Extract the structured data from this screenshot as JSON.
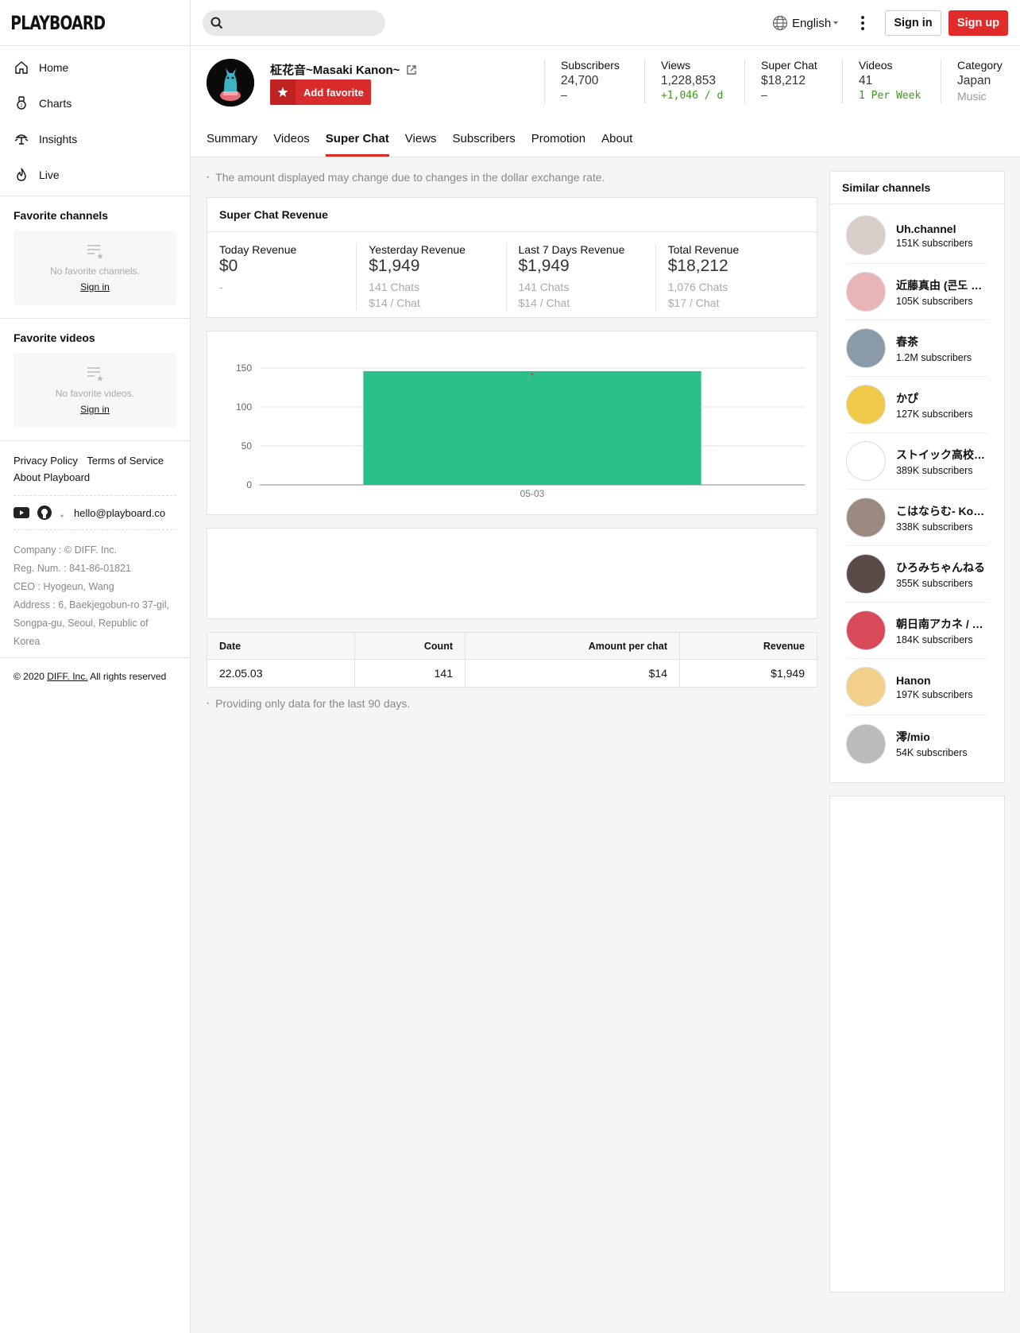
{
  "brand": {
    "logo": "PLAYBOARD"
  },
  "nav": [
    {
      "label": "Home",
      "icon": "home-icon"
    },
    {
      "label": "Charts",
      "icon": "medal-icon"
    },
    {
      "label": "Insights",
      "icon": "bulb-icon"
    },
    {
      "label": "Live",
      "icon": "flame-icon"
    }
  ],
  "favorites": {
    "channels_title": "Favorite channels",
    "channels_empty": "No favorite channels.",
    "videos_title": "Favorite videos",
    "videos_empty": "No favorite videos.",
    "signin": "Sign in"
  },
  "footer": {
    "privacy": "Privacy Policy",
    "terms": "Terms of Service",
    "about": "About Playboard",
    "email": "hello@playboard.co",
    "company": "Company : © DIFF. Inc.",
    "reg": "Reg. Num. : 841-86-01821",
    "ceo": "CEO : Hyogeun, Wang",
    "address": "Address : 6, Baekjegobun-ro 37-gil, Songpa-gu, Seoul, Republic of Korea",
    "copyright_pre": "© 2020",
    "copyright_link": "DIFF. Inc.",
    "copyright_post": "All rights reserved"
  },
  "topbar": {
    "language": "English",
    "signin": "Sign in",
    "signup": "Sign up"
  },
  "channel": {
    "name": "柾花音~Masaki Kanon~",
    "add_favorite": "Add favorite",
    "stats": [
      {
        "label": "Subscribers",
        "value": "24,700",
        "sub": "–",
        "sub_style": "plain"
      },
      {
        "label": "Views",
        "value": "1,228,853",
        "sub": "+1,046 / d",
        "sub_style": "green"
      },
      {
        "label": "Super Chat",
        "value": "$18,212",
        "sub": "–",
        "sub_style": "plain"
      },
      {
        "label": "Videos",
        "value": "41",
        "sub": "1 Per Week",
        "sub_style": "green"
      },
      {
        "label": "Category",
        "value": "Japan",
        "sub": "Music",
        "sub_style": "gray"
      }
    ]
  },
  "tabs": [
    "Summary",
    "Videos",
    "Super Chat",
    "Views",
    "Subscribers",
    "Promotion",
    "About"
  ],
  "active_tab": "Super Chat",
  "notice": "The amount displayed may change due to changes in the dollar exchange rate.",
  "revenue": {
    "title": "Super Chat Revenue",
    "cols": [
      {
        "label": "Today Revenue",
        "value": "$0",
        "line1": "-",
        "line2": ""
      },
      {
        "label": "Yesterday Revenue",
        "value": "$1,949",
        "line1": "141 Chats",
        "line2": "$14 / Chat"
      },
      {
        "label": "Last 7 Days Revenue",
        "value": "$1,949",
        "line1": "141 Chats",
        "line2": "$14 / Chat"
      },
      {
        "label": "Total Revenue",
        "value": "$18,212",
        "line1": "1,076 Chats",
        "line2": "$17 / Chat"
      }
    ]
  },
  "chart_data": {
    "type": "bar",
    "categories": [
      "05-03"
    ],
    "values": [
      146
    ],
    "ylim": [
      0,
      150
    ],
    "yticks": [
      0,
      50,
      100,
      150
    ],
    "grid": true,
    "color": "#2bbf8a"
  },
  "table": {
    "headers": [
      "Date",
      "Count",
      "Amount per chat",
      "Revenue"
    ],
    "rows": [
      [
        "22.05.03",
        "141",
        "$14",
        "$1,949"
      ]
    ]
  },
  "note": "Providing only data for the last 90 days.",
  "similar": {
    "title": "Similar channels",
    "items": [
      {
        "name": "Uh.channel",
        "subs": "151K subscribers",
        "color": "#d9cfc8"
      },
      {
        "name": "近藤真由 (콘도 마유)",
        "subs": "105K subscribers",
        "color": "#e8b4b8"
      },
      {
        "name": "春茶",
        "subs": "1.2M subscribers",
        "color": "#8a9aa8"
      },
      {
        "name": "かぴ",
        "subs": "127K subscribers",
        "color": "#f0c94a"
      },
      {
        "name": "ストイック高校チャンネル",
        "subs": "389K subscribers",
        "color": "#ffffff"
      },
      {
        "name": "こはならむ- Kohanaramu",
        "subs": "338K subscribers",
        "color": "#9c8a80"
      },
      {
        "name": "ひろみちゃんねる",
        "subs": "355K subscribers",
        "color": "#5a4a48"
      },
      {
        "name": "朝日南アカネ / Akane",
        "subs": "184K subscribers",
        "color": "#d84a5a"
      },
      {
        "name": "Hanon",
        "subs": "197K subscribers",
        "color": "#f2d08a"
      },
      {
        "name": "澪/mio",
        "subs": "54K subscribers",
        "color": "#bbbbbb"
      }
    ]
  }
}
